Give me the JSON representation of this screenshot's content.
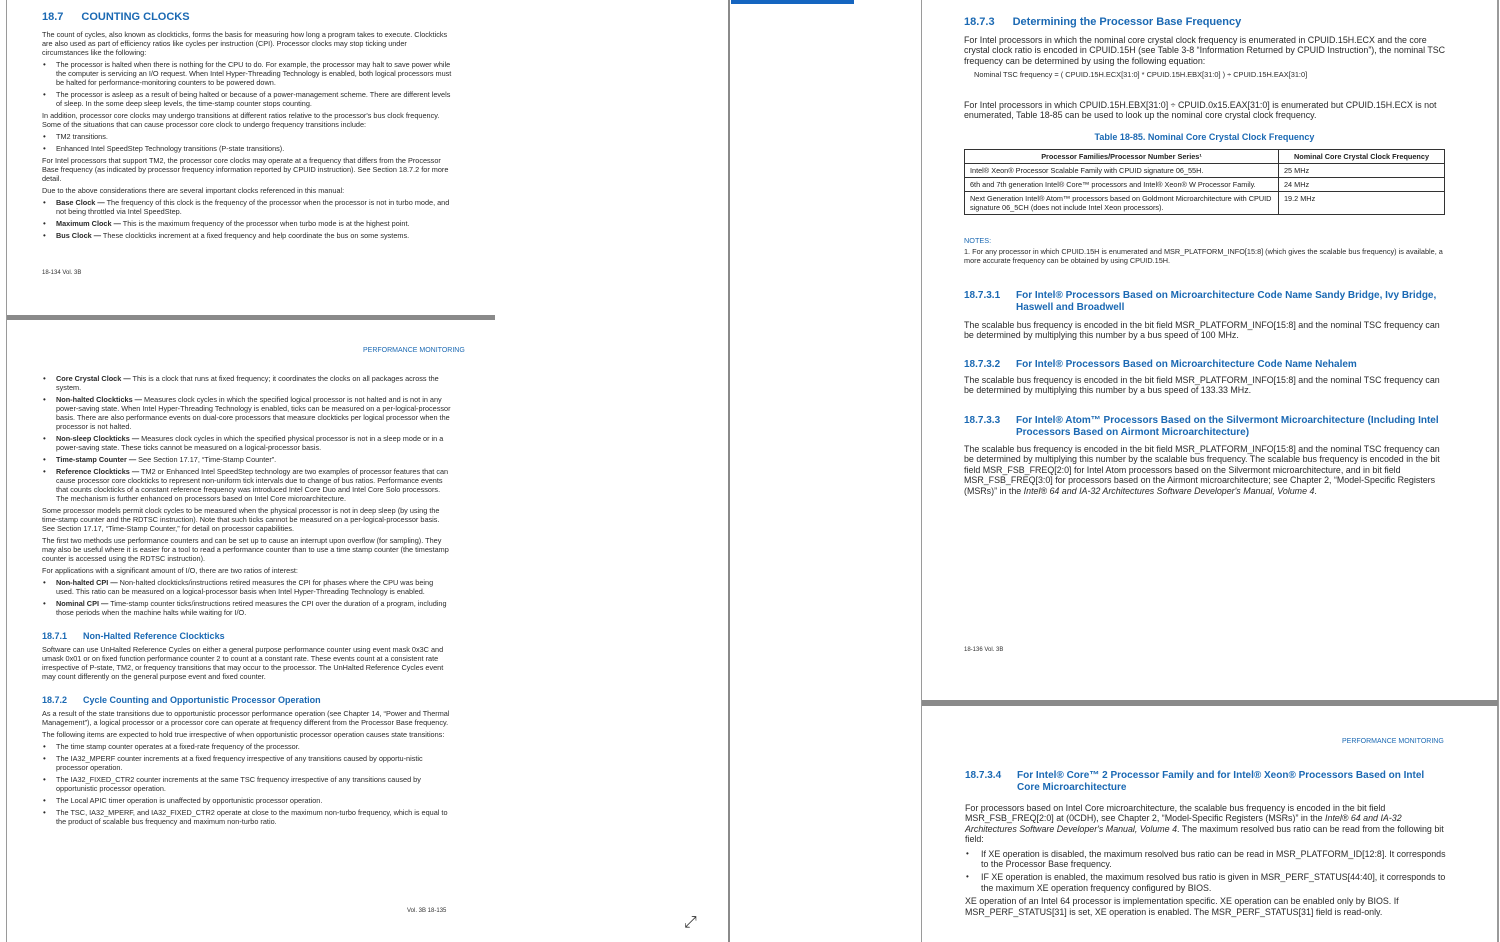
{
  "left_top": {
    "section": {
      "num": "18.7",
      "title": "COUNTING CLOCKS"
    },
    "intro": "The count of cycles, also known as clockticks, forms the basis for measuring how long a program takes to execute. Clockticks are also used as part of efficiency ratios like cycles per instruction (CPI). Processor clocks may stop ticking under circumstances like the following:",
    "bullets1": [
      "The processor is halted when there is nothing for the CPU to do. For example, the processor may halt to save power while the computer is servicing an I/O request. When Intel Hyper-Threading Technology is enabled, both logical processors must be halted for performance-monitoring counters to be powered down.",
      "The processor is asleep as a result of being halted or because of a power-management scheme. There are different levels of sleep. In the some deep sleep levels, the time-stamp counter stops counting."
    ],
    "p2": "In addition, processor core clocks may undergo transitions at different ratios relative to the processor's bus clock frequency. Some of the situations that can cause processor core clock to undergo frequency transitions include:",
    "bullets2": [
      "TM2 transitions.",
      "Enhanced Intel SpeedStep Technology transitions (P-state transitions)."
    ],
    "p3": "For Intel processors that support TM2, the processor core clocks may operate at a frequency that differs from the Processor Base frequency (as indicated by processor frequency information reported by CPUID instruction). See Section 18.7.2 for more detail.",
    "p4": "Due to the above considerations there are several important clocks referenced in this manual:",
    "bullets3": [
      {
        "term": "Base Clock —",
        "text": " The frequency of this clock is the frequency of the processor when the processor is not in turbo mode, and not being throttled via Intel SpeedStep."
      },
      {
        "term": "Maximum Clock —",
        "text": " This is the maximum frequency of the processor when turbo mode is at the highest point."
      },
      {
        "term": "Bus Clock —",
        "text": " These clockticks increment at a fixed frequency and help coordinate the bus on some systems."
      }
    ],
    "footer": "18-134  Vol. 3B"
  },
  "left_bottom": {
    "running_header": "PERFORMANCE MONITORING",
    "bullets1": [
      {
        "term": "Core Crystal Clock —",
        "text": " This is a clock that runs at fixed frequency; it coordinates the clocks on all packages across the system."
      },
      {
        "term": "Non-halted Clockticks —",
        "text": " Measures clock cycles in which the specified logical processor is not halted and is not in any power-saving state. When Intel Hyper-Threading Technology is enabled, ticks can be measured on a per-logical-processor basis. There are also performance events on dual-core processors that measure clockticks per logical processor when the processor is not halted."
      },
      {
        "term": "Non-sleep Clockticks —",
        "text": " Measures clock cycles in which the specified physical processor is not in a sleep mode or in a power-saving state. These ticks cannot be measured on a logical-processor basis."
      },
      {
        "term": "Time-stamp Counter —",
        "text": " See Section 17.17, “Time-Stamp Counter”."
      },
      {
        "term": "Reference Clockticks —",
        "text": " TM2 or Enhanced Intel SpeedStep technology are two examples of processor features that can cause processor core clockticks to represent non-uniform tick intervals due to change of bus ratios. Performance events that counts clockticks of a constant reference frequency was introduced Intel Core Duo and Intel Core Solo processors. The mechanism is further enhanced on processors based on Intel Core microarchitecture."
      }
    ],
    "p1": "Some processor models permit clock cycles to be measured when the physical processor is not in deep sleep (by using the time-stamp counter and the RDTSC instruction). Note that such ticks cannot be measured on a per-logical-processor basis. See Section 17.17, “Time-Stamp Counter,” for detail on processor capabilities.",
    "p2": "The first two methods use performance counters and can be set up to cause an interrupt upon overflow (for sampling). They may also be useful where it is easier for a tool to read a performance counter than to use a time stamp counter (the timestamp counter is accessed using the RDTSC instruction).",
    "p3": "For applications with a significant amount of I/O, there are two ratios of interest:",
    "bullets2": [
      {
        "term": "Non-halted CPI —",
        "text": " Non-halted clockticks/instructions retired measures the CPI for phases where the CPU was being used. This ratio can be measured on a logical-processor basis when Intel Hyper-Threading Technology is enabled."
      },
      {
        "term": "Nominal CPI —",
        "text": " Time-stamp counter ticks/instructions retired measures the CPI over the duration of a program, including those periods when the machine halts while waiting for I/O."
      }
    ],
    "s1": {
      "num": "18.7.1",
      "title": "Non-Halted Reference Clockticks"
    },
    "s1p": "Software can use UnHalted Reference Cycles on either a general purpose performance counter using event mask 0x3C and umask 0x01 or on fixed function performance counter 2 to count at a constant rate. These events count at a consistent rate irrespective of P-state, TM2, or frequency transitions that may occur to the processor. The UnHalted Reference Cycles event may count differently on the general purpose event and fixed counter.",
    "s2": {
      "num": "18.7.2",
      "title": "Cycle Counting and Opportunistic Processor Operation"
    },
    "s2p1": "As a result of the state transitions due to opportunistic processor performance operation (see Chapter 14, “Power and Thermal Management”), a logical processor or a processor core can operate at frequency different from the Processor Base frequency.",
    "s2p2": "The following items are expected to hold true irrespective of when opportunistic processor operation causes state transitions:",
    "bullets3": [
      "The time stamp counter operates at a fixed-rate frequency of the processor.",
      "The IA32_MPERF counter increments at a fixed frequency irrespective of any transitions caused by opportu-nistic processor operation.",
      "The IA32_FIXED_CTR2 counter increments at the same TSC frequency irrespective of any transitions caused by opportunistic processor operation.",
      "The Local APIC timer operation is unaffected by opportunistic processor operation.",
      "The TSC, IA32_MPERF, and IA32_FIXED_CTR2 operate at close to the maximum non-turbo frequency, which is equal to the product of scalable bus frequency and maximum non-turbo ratio."
    ],
    "footer": "Vol. 3B  18-135"
  },
  "right_top": {
    "s3": {
      "num": "18.7.3",
      "title": "Determining the Processor Base Frequency"
    },
    "s3p1": "For Intel processors in which the nominal core crystal clock frequency is enumerated in CPUID.15H.ECX and the core crystal clock ratio is encoded in CPUID.15H (see Table 3-8 “Information Returned by CPUID Instruction”), the nominal TSC frequency can be determined by using the following equation:",
    "equation": "Nominal TSC frequency = ( CPUID.15H.ECX[31:0] * CPUID.15H.EBX[31:0] ) ÷ CPUID.15H.EAX[31:0]",
    "s3p2": "For Intel processors in which CPUID.15H.EBX[31:0] ÷ CPUID.0x15.EAX[31:0] is enumerated but CPUID.15H.ECX is not enumerated, Table 18-85 can be used to look up the nominal core crystal clock frequency.",
    "table_caption": "Table 18-85.  Nominal Core Crystal Clock Frequency",
    "table_headers": [
      "Processor Families/Processor Number Series¹",
      "Nominal Core Crystal Clock Frequency"
    ],
    "table_rows": [
      [
        "Intel® Xeon® Processor Scalable Family with CPUID signature 06_55H.",
        "25 MHz"
      ],
      [
        "6th and 7th generation Intel® Core™ processors and Intel® Xeon® W Processor Family.",
        "24 MHz"
      ],
      [
        "Next Generation Intel® Atom™ processors based on Goldmont Microarchitecture with CPUID signature 06_5CH (does not include Intel Xeon processors).",
        "19.2 MHz"
      ]
    ],
    "notes_label": "NOTES:",
    "note1": "1. For any processor in which CPUID.15H is enumerated and MSR_PLATFORM_INFO[15:8] (which gives the scalable bus frequency) is available, a more accurate frequency can be obtained by using CPUID.15H.",
    "s31": {
      "num": "18.7.3.1",
      "title": "For Intel® Processors Based on Microarchitecture Code Name Sandy Bridge, Ivy Bridge, Haswell and Broadwell"
    },
    "s31p": "The scalable bus frequency is encoded in the bit field MSR_PLATFORM_INFO[15:8] and the nominal TSC frequency can be determined by multiplying this number by a bus speed of 100 MHz.",
    "s32": {
      "num": "18.7.3.2",
      "title": "For Intel® Processors Based on Microarchitecture Code Name Nehalem"
    },
    "s32p": "The scalable bus frequency is encoded in the bit field MSR_PLATFORM_INFO[15:8] and the nominal TSC frequency can be determined by multiplying this number by a bus speed of 133.33 MHz.",
    "s33": {
      "num": "18.7.3.3",
      "title": "For Intel® Atom™ Processors Based on the Silvermont Microarchitecture (Including Intel Processors Based on Airmont Microarchitecture)"
    },
    "s33p_a": "The scalable bus frequency is encoded in the bit field MSR_PLATFORM_INFO[15:8] and the nominal TSC frequency can be determined by multiplying this number by the scalable bus frequency. The scalable bus frequency is encoded in the bit field MSR_FSB_FREQ[2:0] for Intel Atom processors based on the Silvermont microarchitecture, and in bit field MSR_FSB_FREQ[3:0] for processors based on the Airmont microarchitecture; see Chapter 2, “Model-Specific Registers (MSRs)” in the ",
    "s33p_i": "Intel® 64 and IA-32 Architectures Software Developer's Manual, Volume 4",
    "s33p_b": ".",
    "footer": "18-136  Vol. 3B"
  },
  "right_bottom": {
    "running_header": "PERFORMANCE MONITORING",
    "s34": {
      "num": "18.7.3.4",
      "title": "For Intel® Core™ 2 Processor Family and for Intel® Xeon® Processors Based on Intel Core Microarchitecture"
    },
    "s34p_a": "For processors based on Intel Core microarchitecture, the scalable bus frequency is encoded in the bit field MSR_FSB_FREQ[2:0] at (0CDH), see Chapter 2, “Model-Specific Registers (MSRs)” in the ",
    "s34p_i": "Intel® 64 and IA-32 Architectures Software Developer's Manual, Volume 4",
    "s34p_b": ". The maximum resolved bus ratio can be read from the following bit field:",
    "bullets": [
      "If XE operation is disabled, the maximum resolved bus ratio can be read in MSR_PLATFORM_ID[12:8]. It corresponds to the Processor Base frequency.",
      "IF XE operation is enabled, the maximum resolved bus ratio is given in MSR_PERF_STATUS[44:40], it corresponds to the maximum XE operation frequency configured by BIOS."
    ],
    "last": "XE operation of an Intel 64 processor is implementation specific. XE operation can be enabled only by BIOS. If MSR_PERF_STATUS[31] is set, XE operation is enabled. The MSR_PERF_STATUS[31] field is read-only."
  },
  "ui": {
    "resize_glyph": "⤢"
  }
}
